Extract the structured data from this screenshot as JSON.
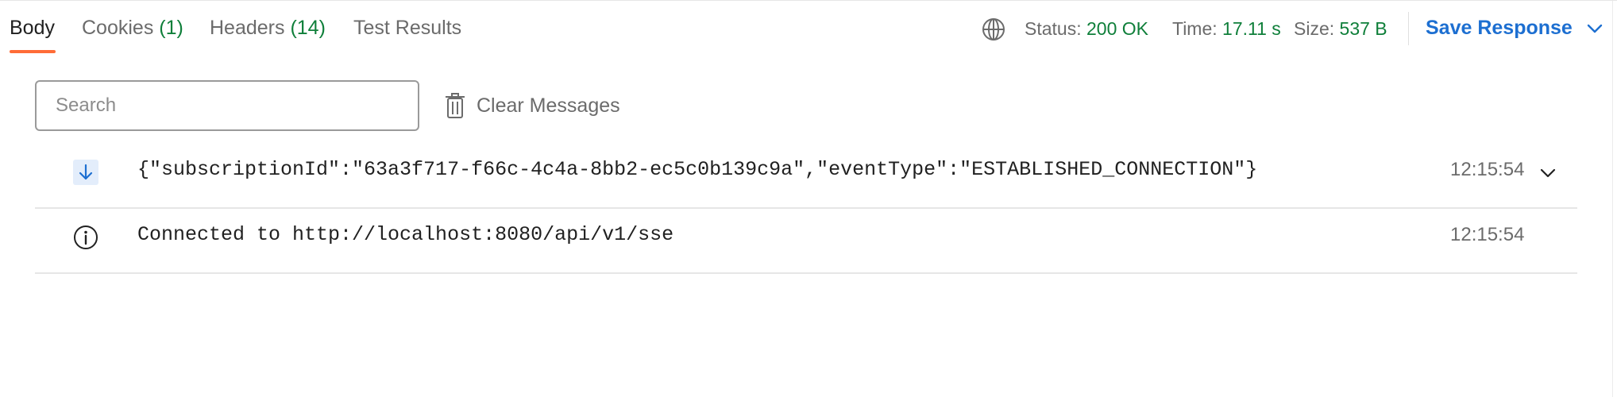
{
  "tabs": [
    {
      "label": "Body",
      "count": ""
    },
    {
      "label": "Cookies",
      "count": "(1)"
    },
    {
      "label": "Headers",
      "count": "(14)"
    },
    {
      "label": "Test Results",
      "count": ""
    }
  ],
  "response_meta": {
    "status_label": "Status:",
    "status_value": "200 OK",
    "time_label": "Time:",
    "time_value": "17.11 s",
    "size_label": "Size:",
    "size_value": "537 B"
  },
  "save_response_label": "Save Response",
  "search": {
    "placeholder": "Search",
    "value": ""
  },
  "clear_messages_label": "Clear Messages",
  "messages": [
    {
      "icon": "arrow-down-icon",
      "text": "{\"subscriptionId\":\"63a3f717-f66c-4c4a-8bb2-ec5c0b139c9a\",\"eventType\":\"ESTABLISHED_CONNECTION\"}",
      "time": "12:15:54"
    },
    {
      "icon": "info-icon",
      "text": "Connected to http://localhost:8080/api/v1/sse",
      "time": "12:15:54"
    }
  ],
  "colors": {
    "active_tab_underline": "#ff6c37",
    "success_value": "#0f7f3a",
    "link_blue": "#1d6fd1",
    "incoming_icon_bg": "#e3edfb"
  }
}
